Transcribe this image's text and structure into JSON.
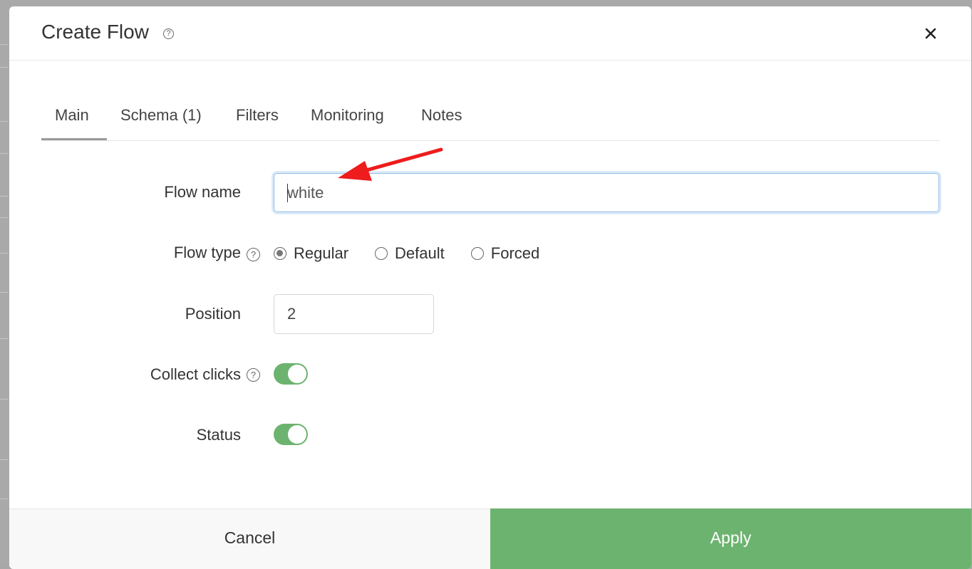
{
  "dialog": {
    "title": "Create Flow"
  },
  "tabs": [
    {
      "label": "Main",
      "active": true
    },
    {
      "label": "Schema (1)",
      "active": false
    },
    {
      "label": "Filters",
      "active": false
    },
    {
      "label": "Monitoring",
      "active": false
    },
    {
      "label": "Notes",
      "active": false
    }
  ],
  "form": {
    "flow_name": {
      "label": "Flow name",
      "value": "white"
    },
    "flow_type": {
      "label": "Flow type",
      "options": [
        {
          "label": "Regular",
          "checked": true
        },
        {
          "label": "Default",
          "checked": false
        },
        {
          "label": "Forced",
          "checked": false
        }
      ]
    },
    "position": {
      "label": "Position",
      "value": "2"
    },
    "collect_clicks": {
      "label": "Collect clicks",
      "on": true
    },
    "status": {
      "label": "Status",
      "on": true
    }
  },
  "footer": {
    "cancel_label": "Cancel",
    "apply_label": "Apply"
  },
  "colors": {
    "accent_green": "#6cb36f",
    "annotation_red": "#ee1c1c"
  },
  "icons": {
    "help": "question-circle-icon",
    "close": "close-icon"
  }
}
